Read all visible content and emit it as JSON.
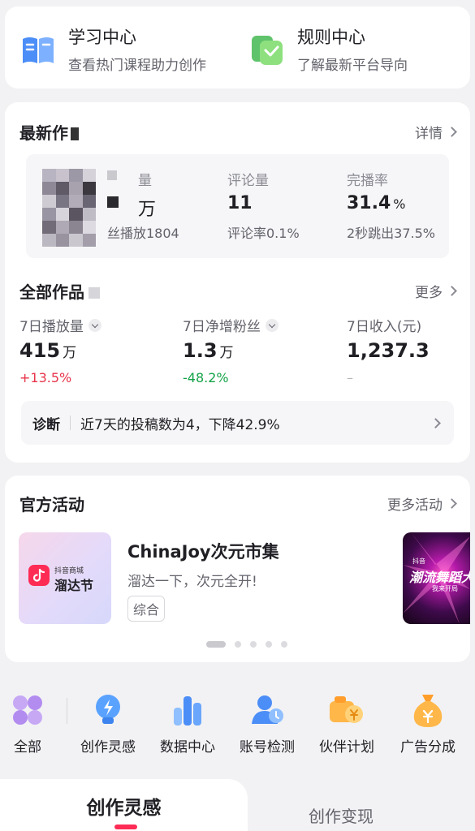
{
  "quick_entries": [
    {
      "title": "学习中心",
      "subtitle": "查看热门课程助力创作",
      "icon": "book-icon"
    },
    {
      "title": "规则中心",
      "subtitle": "了解最新平台导向",
      "icon": "rules-icon"
    }
  ],
  "latest_work": {
    "title": "最新作",
    "more": "详情",
    "play_label": "量",
    "play_value": "万",
    "play_sub": "丝播放1804",
    "comment_label": "评论量",
    "comment_value": "11",
    "comment_sub": "评论率0.1%",
    "completion_label": "完播率",
    "completion_value": "31.4",
    "completion_unit": "%",
    "completion_sub": "2秒跳出37.5%"
  },
  "all_works": {
    "title": "全部作品",
    "more": "更多",
    "stats": [
      {
        "label": "7日播放量",
        "value": "415",
        "unit": "万",
        "delta": "+13.5%",
        "delta_color": "#e8334a"
      },
      {
        "label": "7日净增粉丝",
        "value": "1.3",
        "unit": "万",
        "delta": "-48.2%",
        "delta_color": "#16a34a"
      },
      {
        "label": "7日收入(元)",
        "value": "1,237.3",
        "unit": "",
        "delta": "–",
        "delta_color": "#b5b5bb"
      }
    ],
    "diagnosis_label": "诊断",
    "diagnosis_text": "近7天的投稿数为4，下降42.9%"
  },
  "events": {
    "title": "官方活动",
    "more": "更多活动",
    "item": {
      "brand_small": "抖音商城",
      "brand_big": "溜达节",
      "title": "ChinaJoy次元市集",
      "desc": "溜达一下，次元全开!",
      "tag": "综合"
    },
    "next_item": {
      "brand_small": "抖音",
      "big": "潮流舞蹈大",
      "small": "我来开局"
    }
  },
  "tools": [
    {
      "label": "全部",
      "icon": "grid-icon"
    },
    {
      "label": "创作灵感",
      "icon": "bulb-icon"
    },
    {
      "label": "数据中心",
      "icon": "bar-chart-icon"
    },
    {
      "label": "账号检测",
      "icon": "account-check-icon"
    },
    {
      "label": "伙伴计划",
      "icon": "partner-icon"
    },
    {
      "label": "广告分成",
      "icon": "money-bag-icon"
    }
  ],
  "tabs": [
    {
      "label": "创作灵感",
      "active": true
    },
    {
      "label": "创作变现",
      "active": false
    }
  ],
  "colors": {
    "accent": "#fe2c55",
    "positive": "#e8334a",
    "negative": "#16a34a"
  }
}
